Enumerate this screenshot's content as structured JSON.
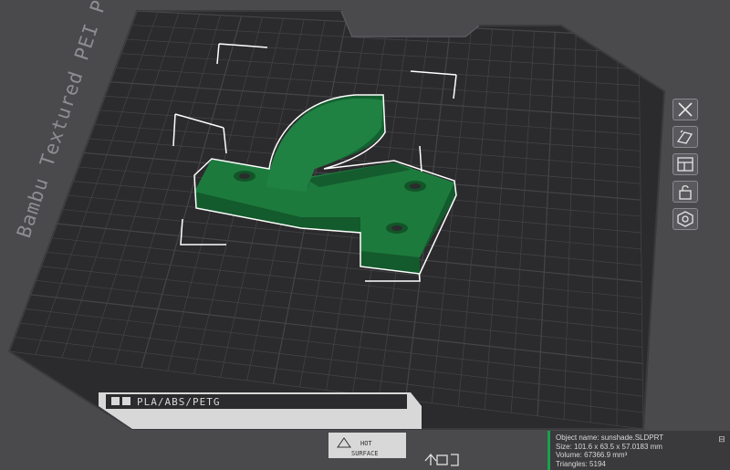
{
  "plate": {
    "name": "Bambu Textured PEI Plate",
    "material_label": "PLA/ABS/PETG",
    "hot_line1": "HOT",
    "hot_line2": "SURFACE"
  },
  "sidebar": {
    "items": [
      {
        "icon": "close-x-icon"
      },
      {
        "icon": "auto-orient-icon"
      },
      {
        "icon": "arrange-icon"
      },
      {
        "icon": "lock-icon"
      },
      {
        "icon": "plate-settings-icon"
      }
    ]
  },
  "object_info": {
    "name": "Object name: sunshade.SLDPRT",
    "size": "Size: 101.6 x 63.5 x 57.0183 mm",
    "volume": "Volume: 67366.9 mm³",
    "triangles": "Triangles: 5194"
  },
  "colors": {
    "background": "#4a4a4d",
    "plate": "#2b2b2d",
    "grid": "#454548",
    "model": "#1d7a3d",
    "model_dark": "#135a2c",
    "accent": "#18a34a"
  }
}
